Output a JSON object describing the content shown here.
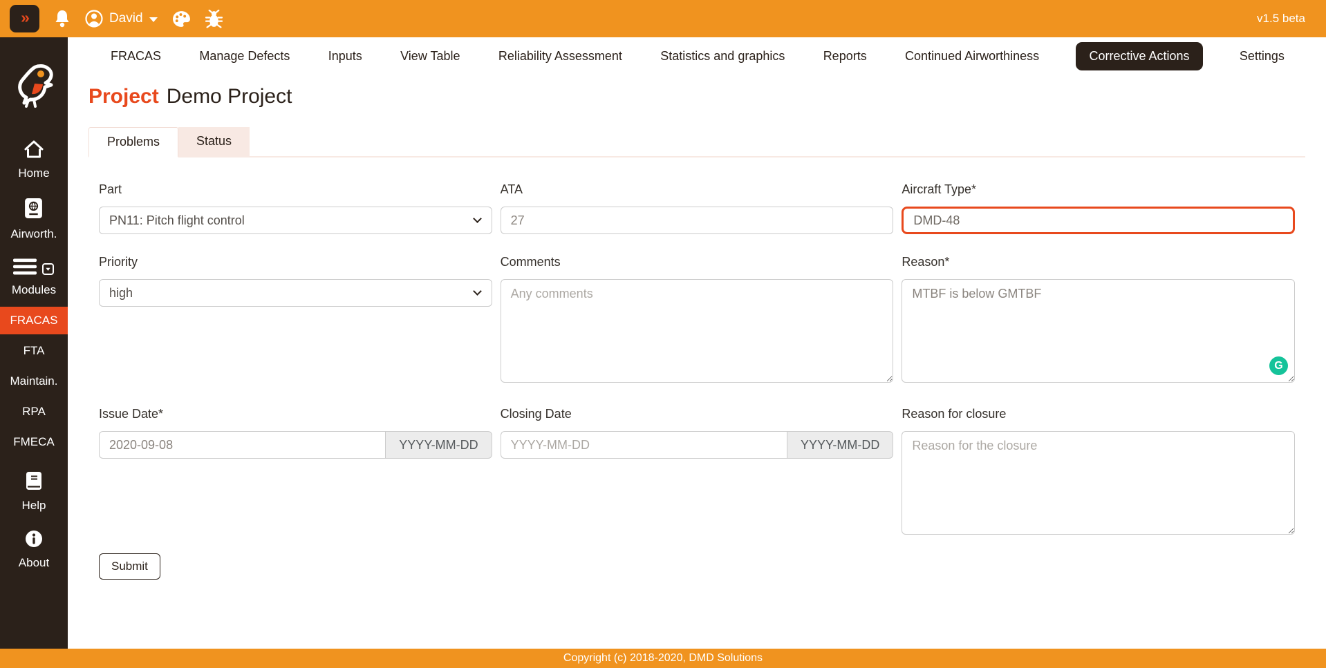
{
  "colors": {
    "accent": "#E8491D",
    "topbar_orange": "#F0931F",
    "sidebar_bg": "#2B211A",
    "grammarly_green": "#15C39A"
  },
  "topbar": {
    "toggle_glyph": "»",
    "username": "David",
    "version": "v1.5 beta"
  },
  "sidebar": {
    "home_label": "Home",
    "airworth_label": "Airworth.",
    "modules_label": "Modules",
    "modules": [
      "FRACAS",
      "FTA",
      "Maintain.",
      "RPA",
      "FMECA"
    ],
    "active_module": "FRACAS",
    "help_label": "Help",
    "about_label": "About"
  },
  "nav": {
    "items": [
      "FRACAS",
      "Manage Defects",
      "Inputs",
      "View Table",
      "Reliability Assessment",
      "Statistics and graphics",
      "Reports",
      "Continued Airworthiness",
      "Corrective Actions",
      "Settings"
    ],
    "active": "Corrective Actions"
  },
  "page": {
    "title_label": "Project",
    "title_value": "Demo Project"
  },
  "tabs": {
    "problems": "Problems",
    "status": "Status",
    "active": "Problems"
  },
  "form": {
    "part": {
      "label": "Part",
      "value": "PN11: Pitch flight control"
    },
    "ata": {
      "label": "ATA",
      "value": "27"
    },
    "aircraft_type": {
      "label": "Aircraft Type*",
      "value": "DMD-48"
    },
    "priority": {
      "label": "Priority",
      "value": "high"
    },
    "comments": {
      "label": "Comments",
      "placeholder": "Any comments"
    },
    "reason": {
      "label": "Reason*",
      "value": "MTBF is below GMTBF"
    },
    "issue_date": {
      "label": "Issue Date*",
      "value": "2020-09-08",
      "format_hint": "YYYY-MM-DD"
    },
    "closing_date": {
      "label": "Closing Date",
      "placeholder": "YYYY-MM-DD",
      "format_hint": "YYYY-MM-DD"
    },
    "closure_reason": {
      "label": "Reason for closure",
      "placeholder": "Reason for the closure"
    },
    "submit_label": "Submit"
  },
  "icons": {
    "grammarly_glyph": "G"
  },
  "footer": {
    "copyright": "Copyright (c) 2018-2020, DMD Solutions"
  }
}
